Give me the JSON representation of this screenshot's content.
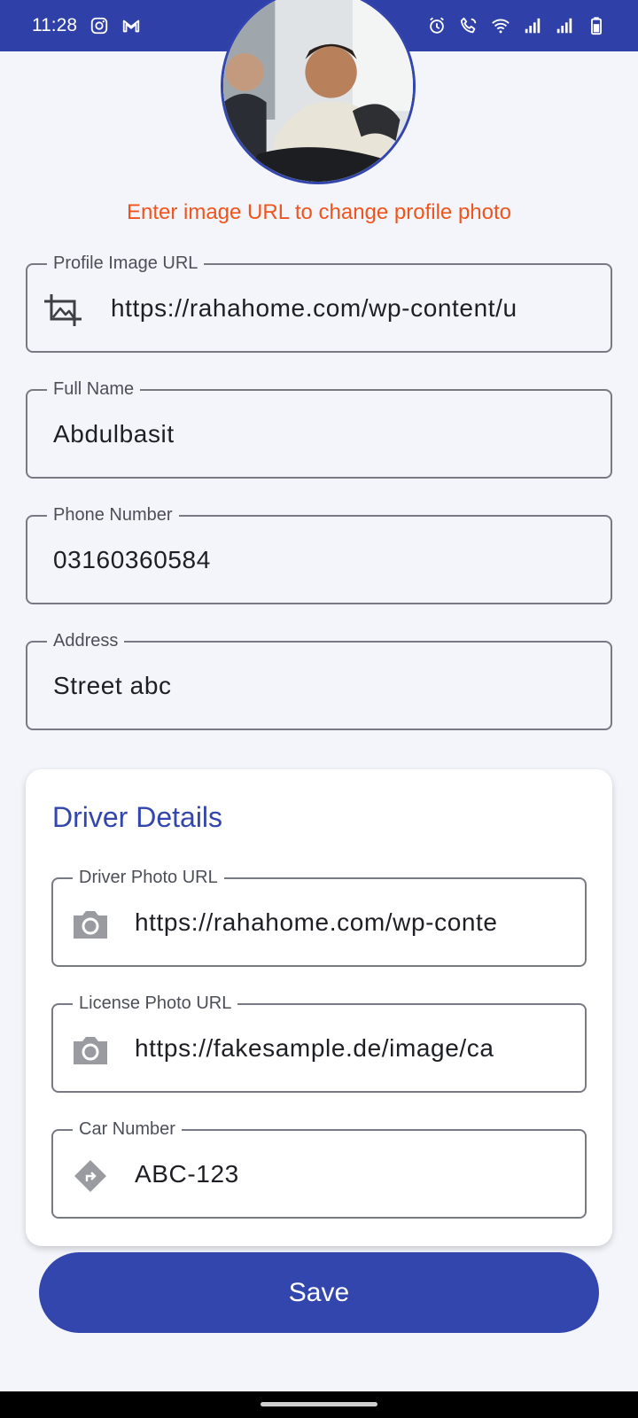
{
  "status_bar": {
    "time": "11:28",
    "left_icons": [
      "instagram-icon",
      "gmail-icon"
    ],
    "right_icons": [
      "alarm-icon",
      "wifi-calling-icon",
      "wifi-icon",
      "signal-icon",
      "signal-icon",
      "battery-icon"
    ]
  },
  "profile": {
    "avatar_alt": "profile-photo",
    "hint": "Enter image URL to change profile photo",
    "fields": {
      "image_url": {
        "label": "Profile Image URL",
        "value": "https://rahahome.com/wp-content/u",
        "icon": "image-crop-icon"
      },
      "full_name": {
        "label": "Full Name",
        "value": "Abdulbasit"
      },
      "phone": {
        "label": "Phone Number",
        "value": "03160360584"
      },
      "address": {
        "label": "Address",
        "value": "Street abc"
      }
    }
  },
  "driver_details": {
    "title": "Driver Details",
    "fields": {
      "driver_photo": {
        "label": "Driver Photo URL",
        "value": "https://rahahome.com/wp-conte",
        "icon": "camera-icon"
      },
      "license_photo": {
        "label": "License Photo URL",
        "value": "https://fakesample.de/image/ca",
        "icon": "camera-icon"
      },
      "car_number": {
        "label": "Car Number",
        "value": "ABC-123",
        "icon": "directions-icon"
      }
    }
  },
  "actions": {
    "save_label": "Save"
  },
  "colors": {
    "primary": "#3346ad",
    "status_bar": "#2f40a8",
    "hint": "#f0541e",
    "background": "#f4f5fa"
  }
}
